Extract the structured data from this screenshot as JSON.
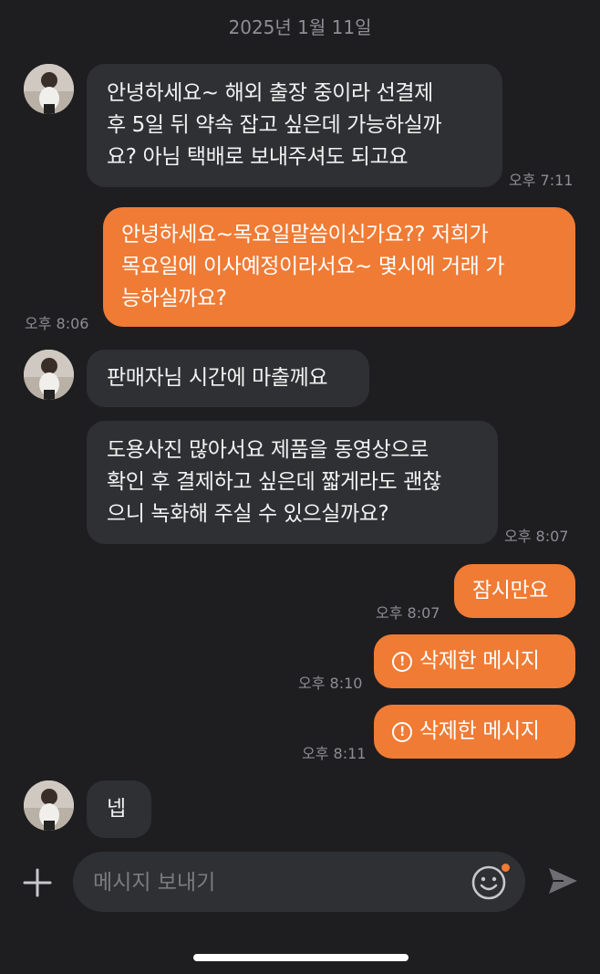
{
  "date_header": "2025년 1월 11일",
  "messages": [
    {
      "lines": [
        "안녕하세요~ 해외 출장 중이라 선결제",
        "후 5일 뒤 약속 잡고 싶은데 가능하실까",
        "요? 아님 택배로 보내주셔도 되고요"
      ],
      "time": "오후 7:11"
    },
    {
      "lines": [
        "안녕하세요~목요일말씀이신가요?? 저희가",
        "목요일에 이사예정이라서요~ 몇시에 거래 가",
        "능하실까요?"
      ],
      "time": "오후 8:06"
    },
    {
      "lines": [
        "판매자님 시간에 마출께요"
      ]
    },
    {
      "lines": [
        "도용사진 많아서요 제품을 동영상으로",
        "확인 후 결제하고 싶은데 짧게라도 괜찮",
        "으니 녹화해 주실 수 있으실까요?"
      ],
      "time": "오후 8:07"
    },
    {
      "lines": [
        "잠시만요"
      ],
      "time": "오후 8:07"
    },
    {
      "lines": [
        "삭제한 메시지"
      ],
      "time": "오후 8:10"
    },
    {
      "lines": [
        "삭제한 메시지"
      ],
      "time": "오후 8:11"
    },
    {
      "lines": [
        "넵"
      ]
    }
  ],
  "composer": {
    "placeholder": "메시지 보내기"
  },
  "icons": {
    "add": "plus-icon",
    "emoji": "emoji-smile-icon",
    "send": "send-icon",
    "deleted": "exclamation-circle-icon"
  },
  "colors": {
    "background": "#1e1e20",
    "incoming_bubble": "#2f3033",
    "outgoing_bubble": "#f07b35",
    "timestamp": "#8e8e93"
  }
}
